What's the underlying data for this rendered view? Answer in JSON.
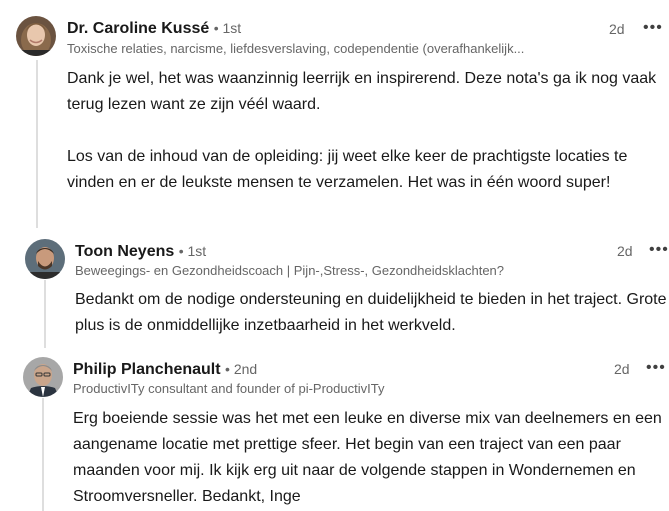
{
  "comments": [
    {
      "author": "Dr. Caroline Kussé",
      "degree": "• 1st",
      "headline": "Toxische relaties, narcisme, liefdesverslaving, codependentie (overafhankelijk...",
      "time": "2d",
      "more": "•••",
      "paragraphs": [
        "Dank je wel, het was waanzinnig leerrijk en inspirerend. Deze nota's ga ik nog vaak terug lezen want ze zijn véél waard.",
        "Los van de inhoud van de opleiding: jij weet elke keer de prachtigste locaties te vinden en er de leukste mensen te verzamelen. Het was in één woord super!"
      ]
    },
    {
      "author": "Toon Neyens",
      "degree": "• 1st",
      "headline": "Beweegings- en Gezondheidscoach | Pijn-,Stress-, Gezondheidsklachten?",
      "time": "2d",
      "more": "•••",
      "paragraphs": [
        "Bedankt om de nodige ondersteuning en duidelijkheid te bieden in het traject. Grote plus is de onmiddellijke inzetbaarheid in het werkveld."
      ]
    },
    {
      "author": "Philip Planchenault",
      "degree": "• 2nd",
      "headline": "ProductivITy consultant and founder of pi-ProductivITy",
      "time": "2d",
      "more": "•••",
      "paragraphs": [
        "Erg boeiende sessie was het met een leuke en diverse mix van deelnemers en een aangename locatie met prettige sfeer. Het begin van een traject van een paar maanden voor mij. Ik kijk erg uit naar de volgende stappen in Wondernemen en Stroomversneller. Bedankt, Inge"
      ]
    }
  ]
}
